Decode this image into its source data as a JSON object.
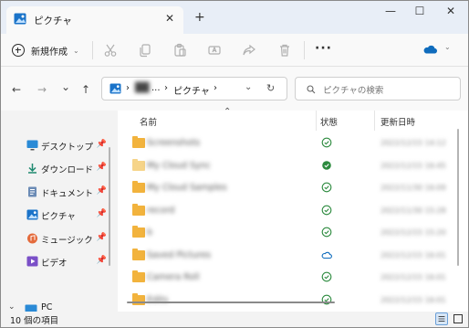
{
  "window": {
    "tab_title": "ピクチャ",
    "new_tab": "+",
    "minimize": "—",
    "maximize": "☐",
    "close": "✕",
    "accent_color": "#1a73c9"
  },
  "toolbar": {
    "new_label": "新規作成",
    "new_caret": "⌄",
    "more": "···",
    "cloud_caret": "⌄",
    "icons": [
      "cut-icon",
      "copy-icon",
      "paste-icon",
      "rename-icon",
      "share-icon",
      "delete-icon"
    ]
  },
  "nav": {
    "back": "←",
    "forward": "→",
    "recent": "⌄",
    "up": "↑",
    "refresh": "↻",
    "dropdown": "⌄"
  },
  "address": {
    "sep1": "›",
    "user": "██",
    "ellipsis": "...",
    "sep2": "›",
    "current": "ピクチャ",
    "sep3": "›"
  },
  "search": {
    "placeholder": "ピクチャの検索"
  },
  "sidebar": {
    "items": [
      {
        "label": "デスクトップ",
        "icon": "desktop-icon",
        "pinned": true
      },
      {
        "label": "ダウンロード",
        "icon": "download-icon",
        "pinned": true
      },
      {
        "label": "ドキュメント",
        "icon": "document-icon",
        "pinned": true
      },
      {
        "label": "ピクチャ",
        "icon": "pictures-icon",
        "pinned": true
      },
      {
        "label": "ミュージック",
        "icon": "music-icon",
        "pinned": true
      },
      {
        "label": "ビデオ",
        "icon": "video-icon",
        "pinned": true
      }
    ],
    "pin_glyph": "📌",
    "pc_label": "PC",
    "pc_caret": "⌄"
  },
  "columns": {
    "name": "名前",
    "status": "状態",
    "modified": "更新日時",
    "sort_glyph": "⌃"
  },
  "files": [
    {
      "name": "Screenshots",
      "status": "synced",
      "date": "2022/12/15 14:12"
    },
    {
      "name": "My Cloud Sync",
      "status": "available",
      "date": "2022/12/15 16:45"
    },
    {
      "name": "My Cloud Samples",
      "status": "synced",
      "date": "2022/11/30 16:09"
    },
    {
      "name": "record",
      "status": "synced",
      "date": "2022/11/30 15:28"
    },
    {
      "name": "b",
      "status": "synced",
      "date": "2022/12/15 15:20"
    },
    {
      "name": "Saved Pictures",
      "status": "cloud",
      "date": "2022/12/15 16:01"
    },
    {
      "name": "Camera Roll",
      "status": "synced",
      "date": "2022/12/15 16:01"
    },
    {
      "name": "Edits",
      "status": "synced",
      "date": "2022/12/15 16:01"
    }
  ],
  "statusbar": {
    "count": "10 個の項目"
  }
}
